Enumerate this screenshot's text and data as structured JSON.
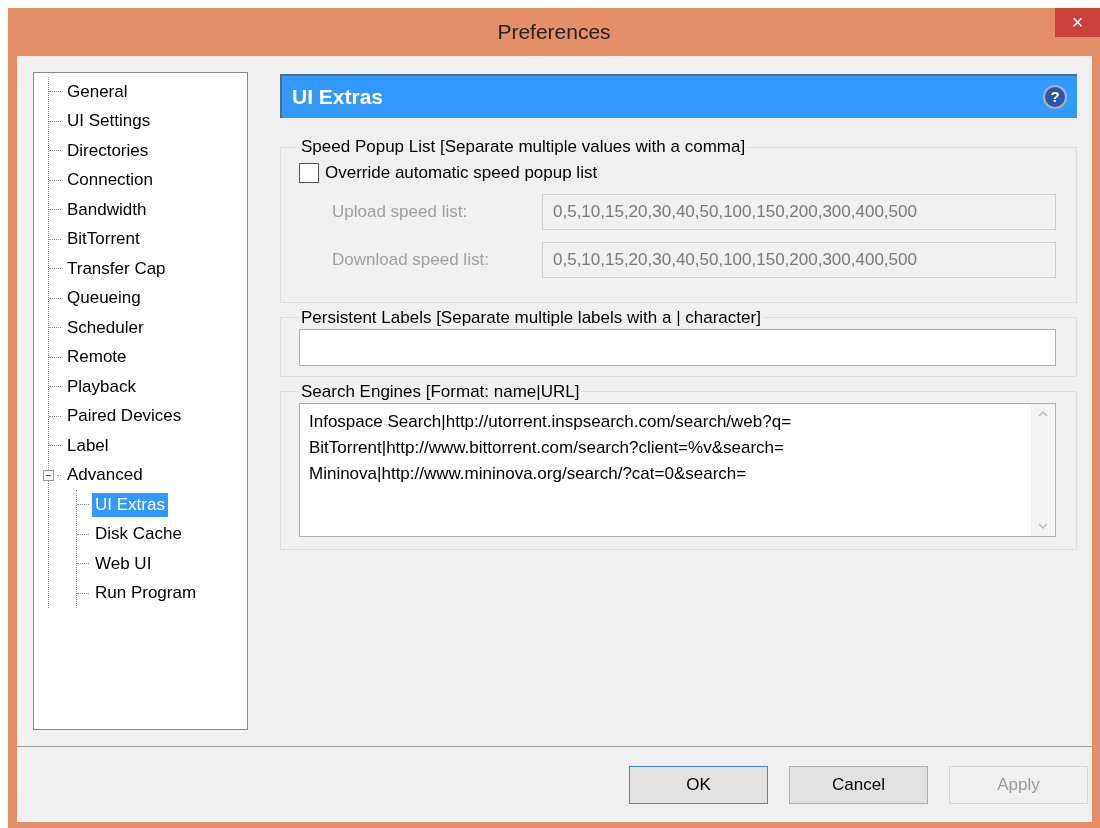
{
  "window": {
    "title": "Preferences",
    "close": "×"
  },
  "tree": [
    {
      "label": "General",
      "selected": false
    },
    {
      "label": "UI Settings",
      "selected": false
    },
    {
      "label": "Directories",
      "selected": false
    },
    {
      "label": "Connection",
      "selected": false
    },
    {
      "label": "Bandwidth",
      "selected": false
    },
    {
      "label": "BitTorrent",
      "selected": false
    },
    {
      "label": "Transfer Cap",
      "selected": false
    },
    {
      "label": "Queueing",
      "selected": false
    },
    {
      "label": "Scheduler",
      "selected": false
    },
    {
      "label": "Remote",
      "selected": false
    },
    {
      "label": "Playback",
      "selected": false
    },
    {
      "label": "Paired Devices",
      "selected": false
    },
    {
      "label": "Label",
      "selected": false
    },
    {
      "label": "Advanced",
      "selected": false,
      "expanded": true,
      "children": [
        {
          "label": "UI Extras",
          "selected": true
        },
        {
          "label": "Disk Cache",
          "selected": false
        },
        {
          "label": "Web UI",
          "selected": false
        },
        {
          "label": "Run Program",
          "selected": false
        }
      ]
    }
  ],
  "header": {
    "title": "UI Extras",
    "help": "?"
  },
  "speed_group": {
    "legend": "Speed Popup List [Separate multiple values with a comma]",
    "checkbox": {
      "label": "Override automatic speed popup list",
      "checked": false
    },
    "fields": [
      {
        "label": "Upload speed list:",
        "value": "0,5,10,15,20,30,40,50,100,150,200,300,400,500",
        "disabled": true
      },
      {
        "label": "Download speed list:",
        "value": "0,5,10,15,20,30,40,50,100,150,200,300,400,500",
        "disabled": true
      }
    ]
  },
  "labels_group": {
    "legend": "Persistent Labels [Separate multiple labels with a | character]"
  },
  "search_group": {
    "legend": "Search Engines [Format: name|URL]",
    "lines": [
      "Infospace Search|http://utorrent.inspsearch.com/search/web?q=",
      "BitTorrent|http://www.bittorrent.com/search?client=%v&search=",
      "Mininova|http://www.mininova.org/search/?cat=0&search="
    ]
  },
  "buttons": [
    {
      "label": "OK",
      "kind": "default",
      "disabled": false
    },
    {
      "label": "Cancel",
      "kind": "normal",
      "disabled": false
    },
    {
      "label": "Apply",
      "kind": "normal",
      "disabled": true
    }
  ]
}
